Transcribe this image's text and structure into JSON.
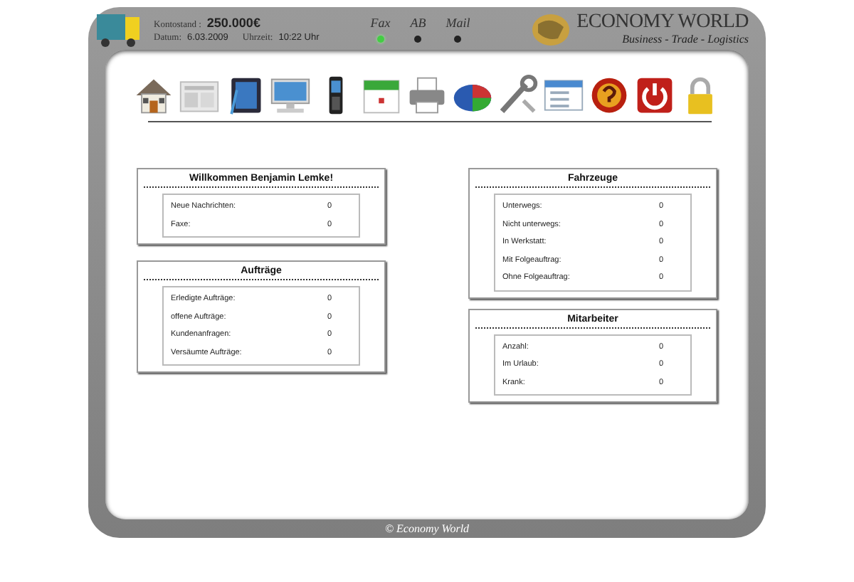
{
  "header": {
    "balance_label": "Kontostand :",
    "balance_value": "250.000€",
    "date_label": "Datum:",
    "date_value": "6.03.2009",
    "time_label": "Uhrzeit:",
    "time_value": "10:22 Uhr",
    "indicators": [
      {
        "label": "Fax",
        "on": true
      },
      {
        "label": "AB",
        "on": false
      },
      {
        "label": "Mail",
        "on": false
      }
    ],
    "brand": "ECONOMY WORLD",
    "tagline": "Business - Trade - Logistics"
  },
  "left_panels": [
    {
      "title": "Willkommen Benjamin Lemke!",
      "rows": [
        {
          "label": "Neue Nachrichten:",
          "value": "0"
        },
        {
          "label": "Faxe:",
          "value": "0"
        }
      ]
    },
    {
      "title": "Aufträge",
      "rows": [
        {
          "label": "Erledigte Aufträge:",
          "value": "0"
        },
        {
          "label": "offene Aufträge:",
          "value": "0"
        },
        {
          "label": "Kundenanfragen:",
          "value": "0"
        },
        {
          "label": "Versäumte Aufträge:",
          "value": "0"
        }
      ]
    }
  ],
  "right_panels": [
    {
      "title": "Fahrzeuge",
      "rows": [
        {
          "label": "Unterwegs:",
          "value": "0"
        },
        {
          "label": "Nicht unterwegs:",
          "value": "0"
        },
        {
          "label": "In Werkstatt:",
          "value": "0"
        },
        {
          "label": "Mit Folgeauftrag:",
          "value": "0"
        },
        {
          "label": "Ohne Folgeauftrag:",
          "value": "0"
        }
      ]
    },
    {
      "title": "Mitarbeiter",
      "rows": [
        {
          "label": "Anzahl:",
          "value": "0"
        },
        {
          "label": "Im Urlaub:",
          "value": "0"
        },
        {
          "label": "Krank:",
          "value": "0"
        }
      ]
    }
  ],
  "footer": "© Economy World"
}
